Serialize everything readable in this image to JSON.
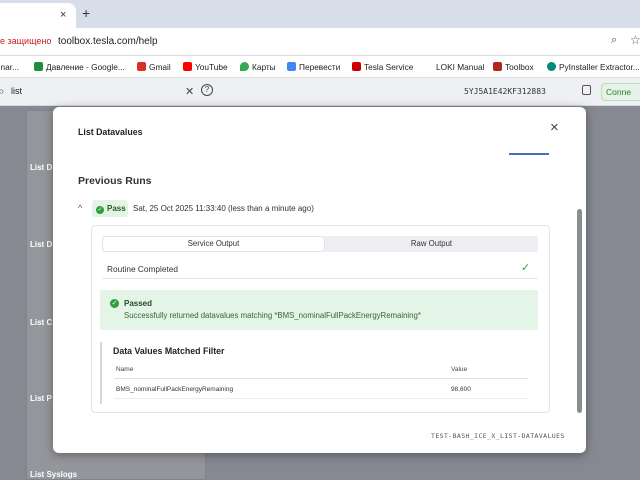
{
  "browser": {
    "tab_close": "×",
    "new_tab": "+",
    "not_secure": "е защищено",
    "url": "toolbox.tesla.com/help",
    "bookmarks": [
      {
        "label": "llinar...",
        "color": "#999999"
      },
      {
        "label": "Давление - Google...",
        "color": "#1e8e3e"
      },
      {
        "label": "Gmail",
        "color": "#d93025"
      },
      {
        "label": "YouTube",
        "color": "#ff0000"
      },
      {
        "label": "Карты",
        "color": "#34a853"
      },
      {
        "label": "Перевести",
        "color": "#4285f4"
      },
      {
        "label": "Tesla Service",
        "color": "#cc0000"
      },
      {
        "label": "LOKI Manual",
        "color": "#ffffff"
      },
      {
        "label": "Toolbox",
        "color": "#b3261e"
      },
      {
        "label": "PyInstaller Extractor...",
        "color": "#00897b"
      }
    ]
  },
  "app": {
    "search_value": "list",
    "vin": "5YJ5A1E42KF312883",
    "connect_label": "Conne"
  },
  "sidebar": {
    "items": [
      "List D",
      "List D",
      "List C",
      "List P",
      "List Syslogs"
    ]
  },
  "modal": {
    "title": "List Datavalues",
    "close": "×",
    "section_title": "Previous Runs",
    "run": {
      "chevron": "^",
      "status": "Pass",
      "timestamp": "Sat, 25 Oct 2025 11:33:40 (less than a minute ago)",
      "tabs": [
        "Service Output",
        "Raw Output"
      ],
      "active_tab": "Service Output",
      "routine": "Routine Completed",
      "passed_title": "Passed",
      "passed_message": "Successfully returned datavalues matching *BMS_nominalFullPackEnergyRemaining*",
      "matched_title": "Data Values Matched Filter",
      "columns": [
        "Name",
        "Value"
      ],
      "rows": [
        [
          "BMS_nominalFullPackEnergyRemaining",
          "98.600"
        ]
      ]
    },
    "footer_code": "TEST-BASH_ICE_X_LIST-DATAVALUES"
  },
  "colors": {
    "accent": "#3e6ec7",
    "pass": "#2e9e3e",
    "pass_bg": "#e4f4e6"
  }
}
